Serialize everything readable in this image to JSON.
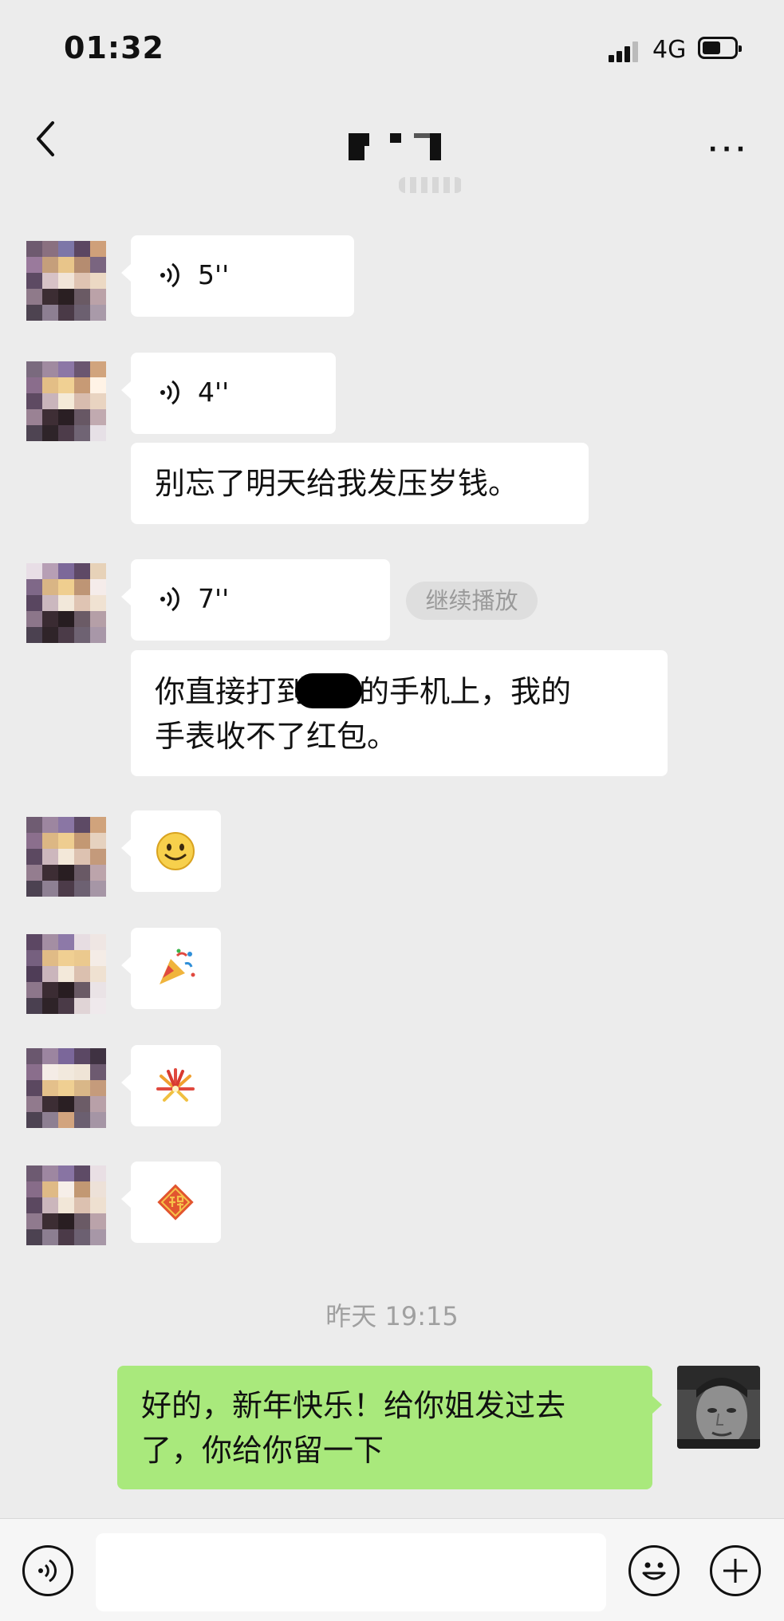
{
  "status_bar": {
    "time": "01:32",
    "network": "4G"
  },
  "header": {
    "back_icon": "chevron-left-icon",
    "more_label": "···"
  },
  "messages": [
    {
      "type": "voice",
      "duration": "5''"
    },
    {
      "type": "voice",
      "duration": "4''"
    },
    {
      "type": "text",
      "text": "别忘了明天给我发压岁钱。"
    },
    {
      "type": "voice",
      "duration": "7''",
      "action": "继续播放"
    },
    {
      "type": "text",
      "lines": [
        "你直接打到",
        "的手机上，我的",
        "手表收不了红包。"
      ]
    },
    {
      "type": "emoji",
      "icon": "smile-emoji-icon"
    },
    {
      "type": "emoji",
      "icon": "party-popper-emoji-icon"
    },
    {
      "type": "emoji",
      "icon": "fireworks-emoji-icon"
    },
    {
      "type": "emoji",
      "icon": "fu-blessing-emoji-icon"
    }
  ],
  "divider_time": "昨天 19:15",
  "outgoing": {
    "lines": [
      "好的，新年快乐！给你姐发过去",
      "了，你给你留一下"
    ]
  },
  "input_bar": {
    "voice_icon": "voice-toggle-icon",
    "emoji_icon": "emoji-icon",
    "plus_icon": "plus-icon"
  },
  "colors": {
    "background": "#ececec",
    "incoming_bubble": "#ffffff",
    "outgoing_bubble": "#a9e97c"
  }
}
